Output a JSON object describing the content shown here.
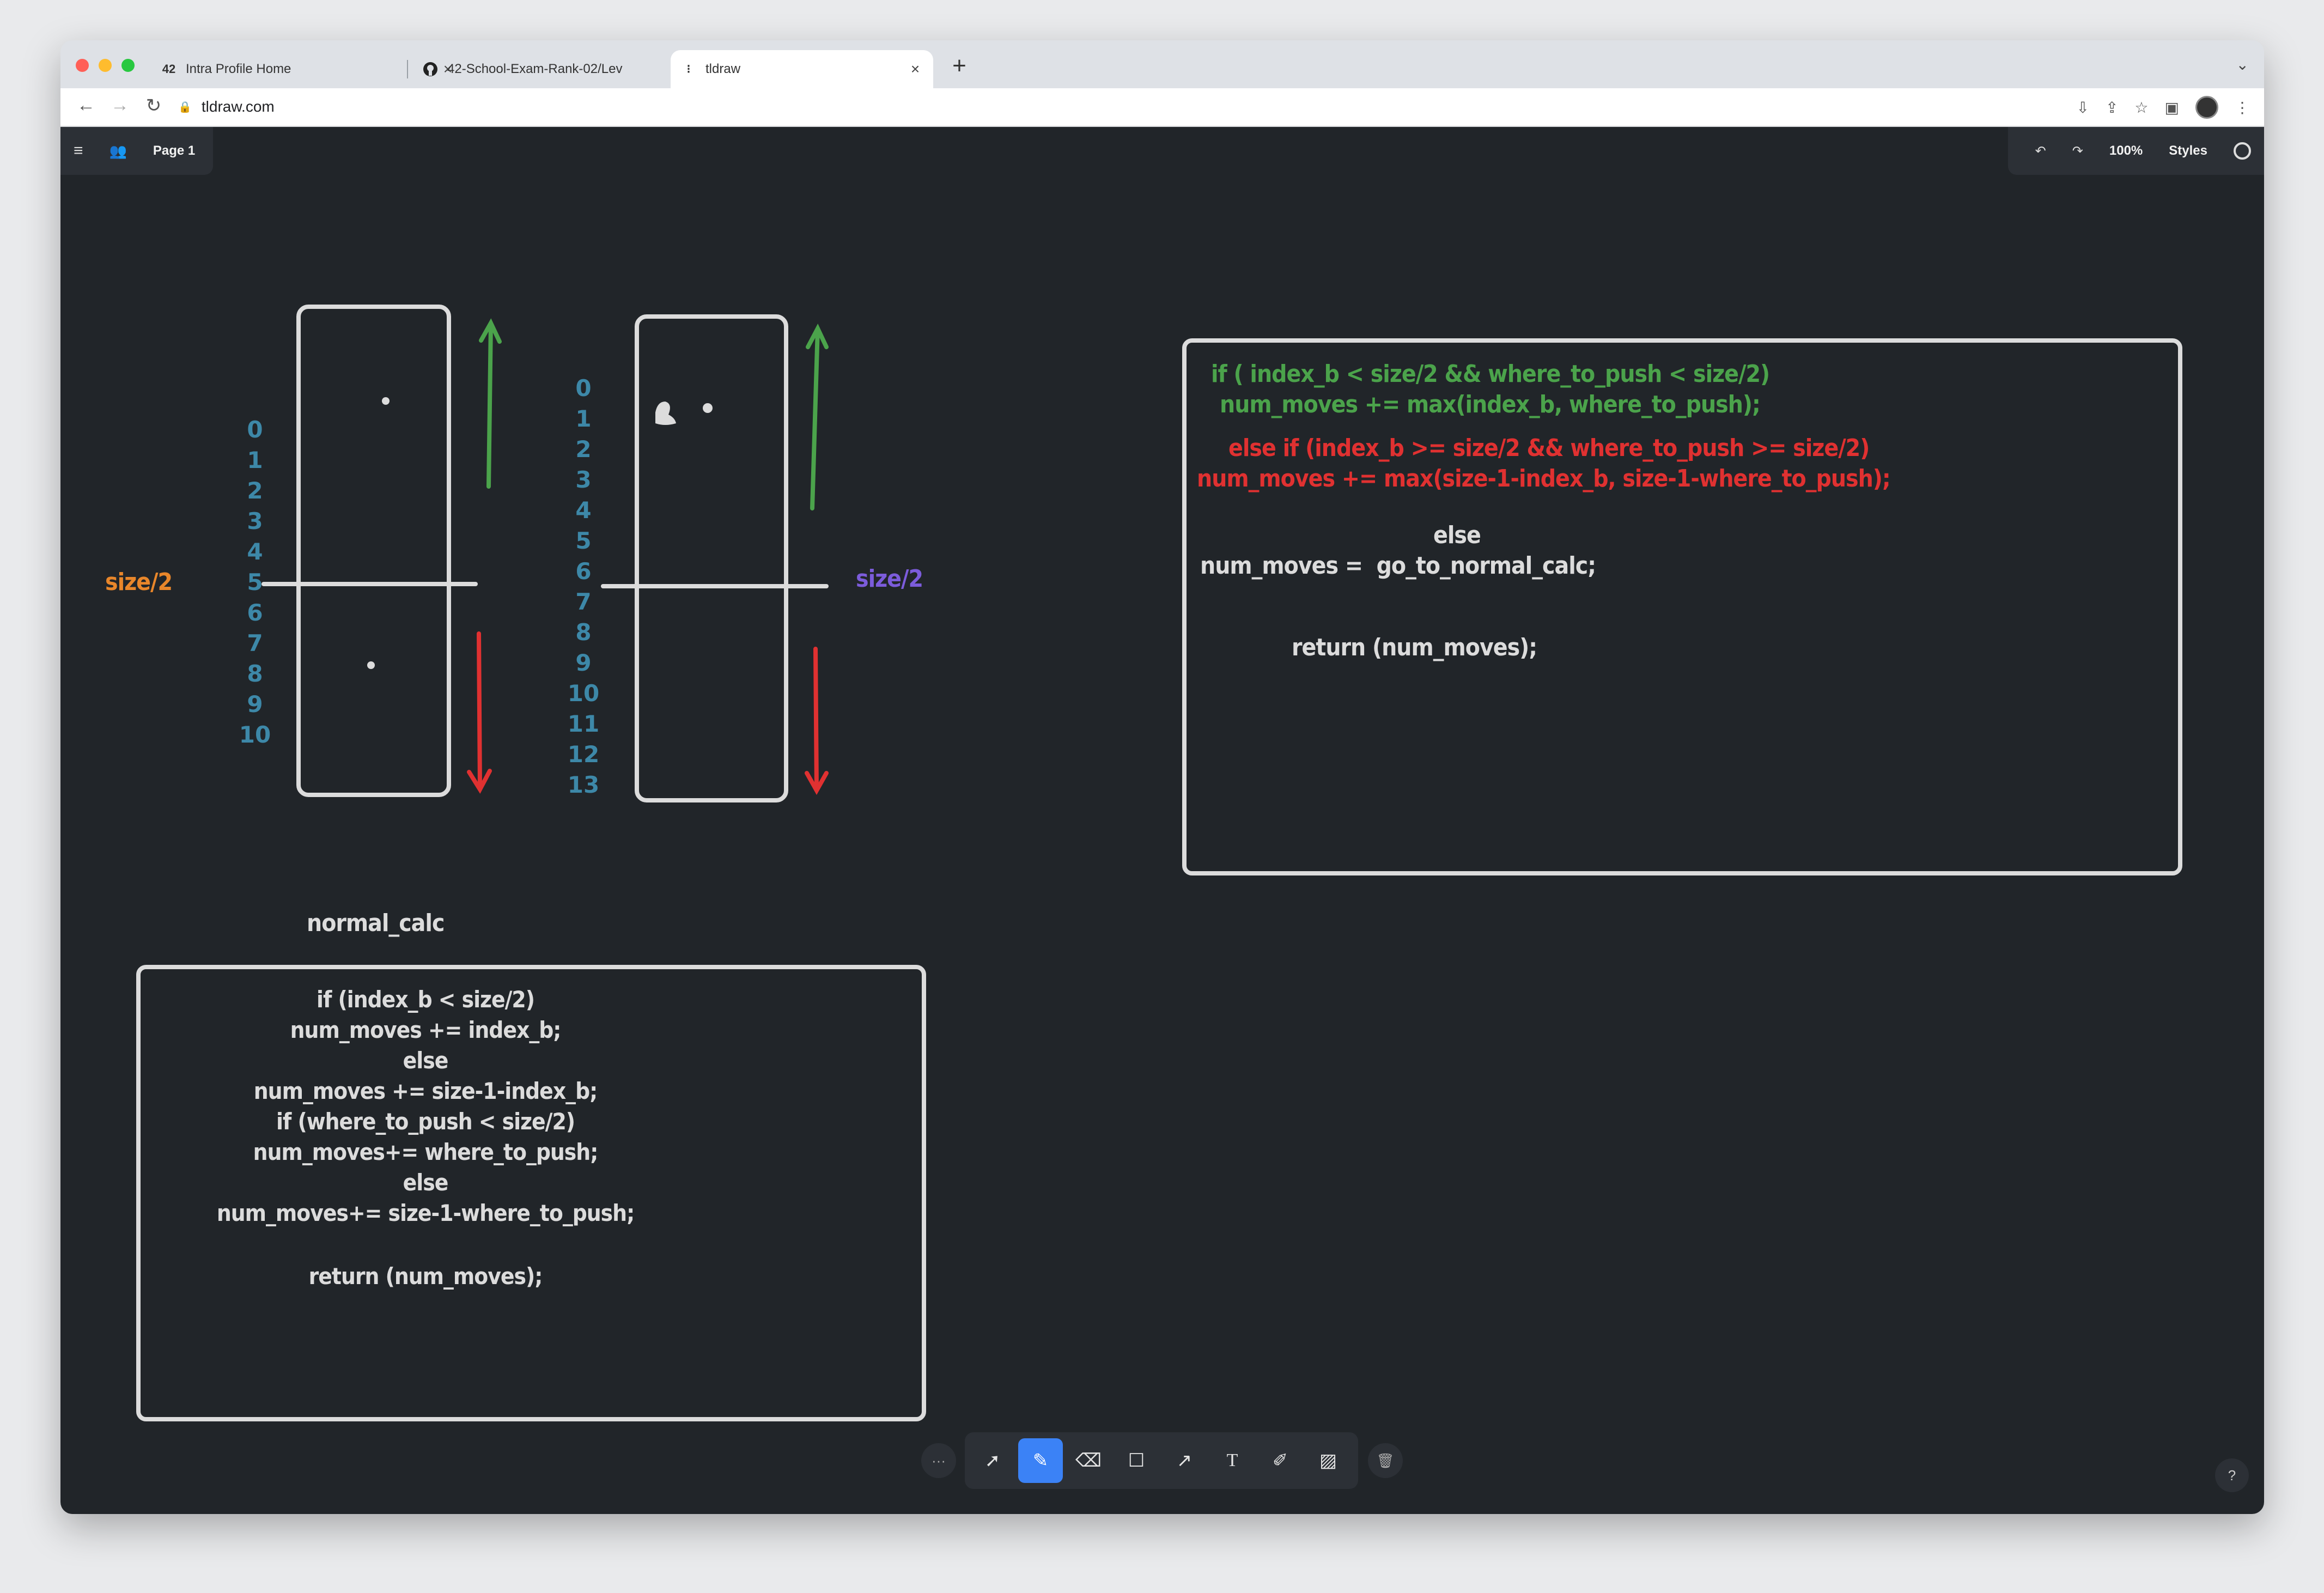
{
  "browser": {
    "tabs": [
      {
        "title": "Intra Profile Home",
        "icon": "42-logo-icon"
      },
      {
        "title": "42-School-Exam-Rank-02/Lev",
        "icon": "github-icon"
      },
      {
        "title": "tldraw",
        "icon": "tldraw-icon"
      }
    ],
    "url": "tldraw.com"
  },
  "app": {
    "page_label": "Page 1",
    "zoom": "100%",
    "styles_label": "Styles",
    "help_label": "?"
  },
  "canvas": {
    "left_numbers": [
      "0",
      "1",
      "2",
      "3",
      "4",
      "5",
      "6",
      "7",
      "8",
      "9",
      "10"
    ],
    "right_numbers": [
      "0",
      "1",
      "2",
      "3",
      "4",
      "5",
      "6",
      "7",
      "8",
      "9",
      "10",
      "11",
      "12",
      "13"
    ],
    "size_label_left": "size/2",
    "size_label_right": "size/2",
    "normal_calc_title": "normal_calc",
    "normal_calc_code": [
      "if (index_b < size/2)",
      "num_moves += index_b;",
      "else",
      "num_moves += size-1-index_b;",
      "if (where_to_push < size/2)",
      "num_moves+= where_to_push;",
      "else",
      "num_moves+= size-1-where_to_push;",
      "return (num_moves);"
    ],
    "right_code": {
      "green_1": "if ( index_b < size/2 && where_to_push < size/2)",
      "green_2": "num_moves += max(index_b, where_to_push);",
      "red_1": "else if (index_b >= size/2 && where_to_push >= size/2)",
      "red_2": "num_moves += max(size-1-index_b, size-1-where_to_push);",
      "else": "else",
      "normal": "num_moves =  go_to_normal_calc;",
      "return": "return (num_moves);"
    },
    "colors": {
      "green": "#4ba34b",
      "red": "#e03131",
      "orange": "#e8862a",
      "violet": "#7c5cdb",
      "blue": "#3d88a8",
      "white": "#dcdcdc"
    }
  }
}
